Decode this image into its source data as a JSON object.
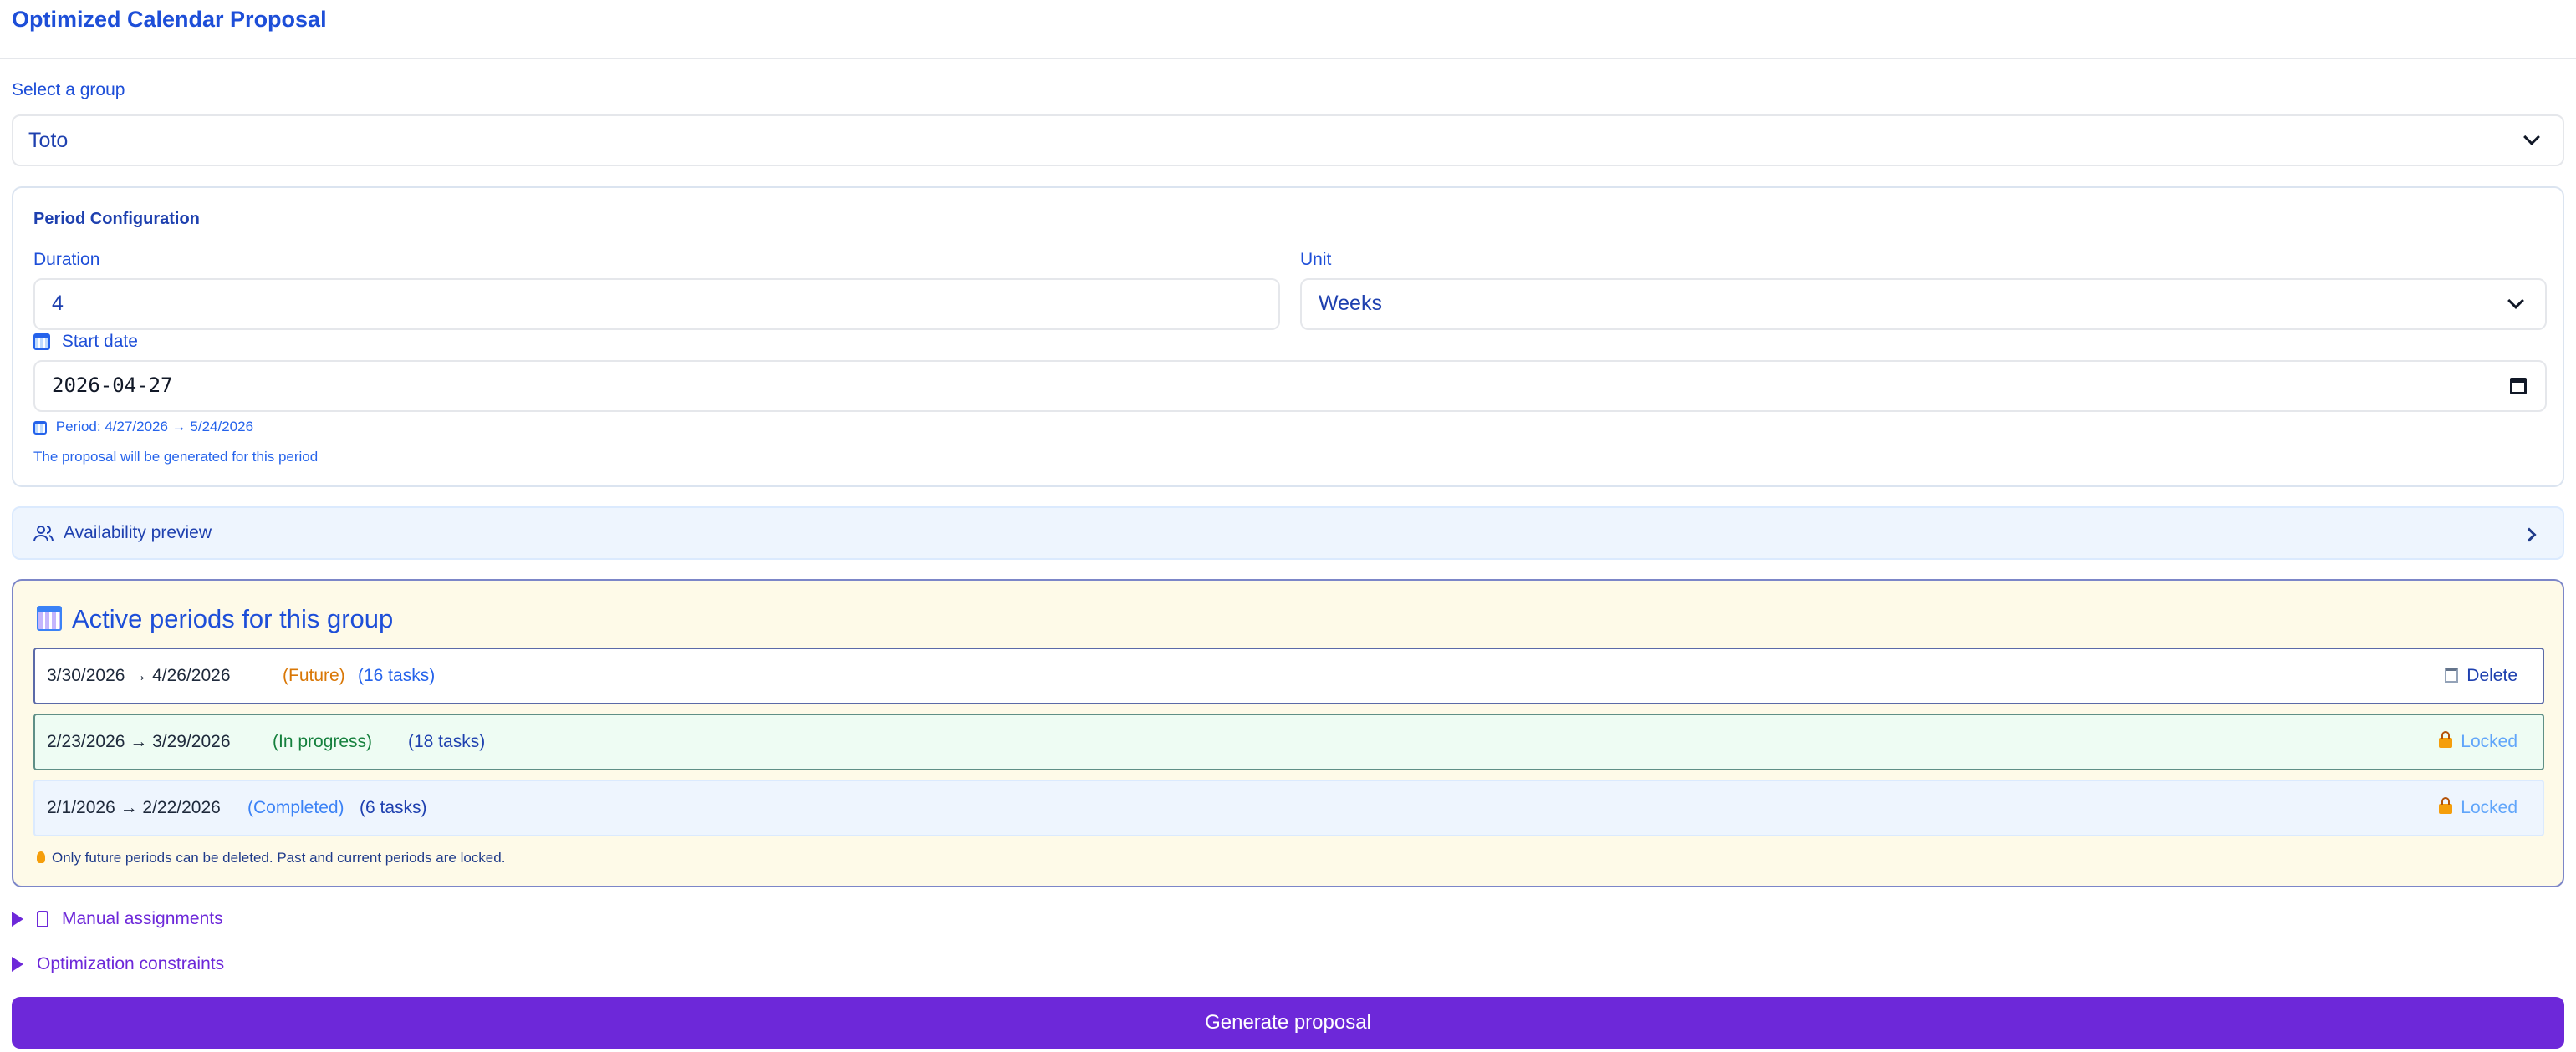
{
  "header": {
    "title": "Optimized Calendar Proposal"
  },
  "group": {
    "label": "Select a group",
    "selected": "Toto"
  },
  "period_config": {
    "title": "Period Configuration",
    "duration_label": "Duration",
    "duration_value": "4",
    "unit_label": "Unit",
    "unit_value": "Weeks",
    "start_label": "Start date",
    "start_value": "2026-04-27",
    "period_text": "Period: 4/27/2026 → 5/24/2026",
    "note": "The proposal will be generated for this period"
  },
  "availability": {
    "label": "Availability preview"
  },
  "active_periods": {
    "title": "Active periods for this group",
    "rows": [
      {
        "dates": "3/30/2026 → 4/26/2026",
        "status": "(Future)",
        "tasks": "(16 tasks)",
        "action": "Delete"
      },
      {
        "dates": "2/23/2026 → 3/29/2026",
        "status": "(In progress)",
        "tasks": "(18 tasks)",
        "action": "Locked"
      },
      {
        "dates": "2/1/2026 → 2/22/2026",
        "status": "(Completed)",
        "tasks": "(6 tasks)",
        "action": "Locked"
      }
    ],
    "hint": "Only future periods can be deleted. Past and current periods are locked."
  },
  "sections": {
    "manual_assignments": "Manual assignments",
    "optimization_constraints": "Optimization constraints"
  },
  "generate_button": "Generate proposal",
  "colors": {
    "primary": "#6d28d9",
    "future": "#d97706",
    "in_progress": "#15803d",
    "completed": "#3b82f6",
    "locked": "#60a5fa"
  }
}
